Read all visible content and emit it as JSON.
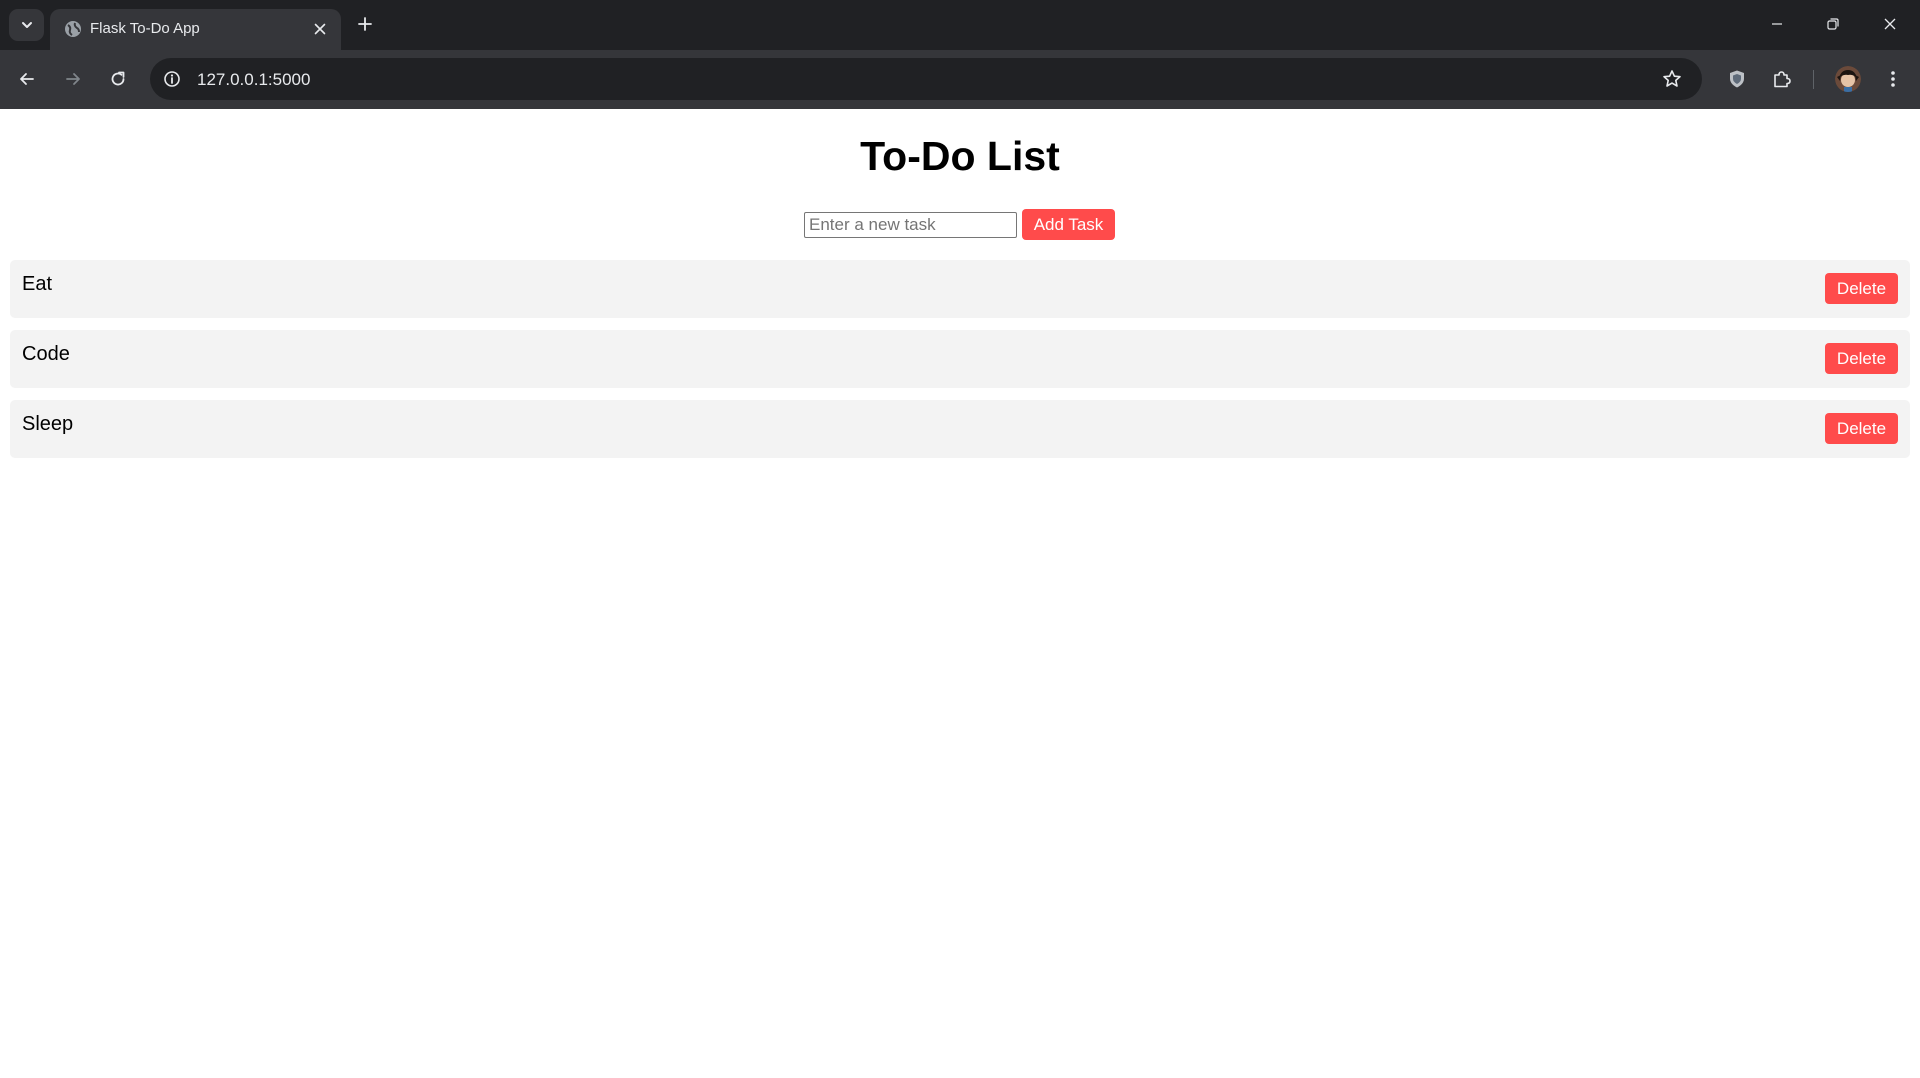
{
  "browser": {
    "tab_title": "Flask To-Do App",
    "url": "127.0.0.1:5000",
    "icons": {
      "tab_search": "chevron-down-icon",
      "favicon": "globe-icon",
      "tab_close": "close-icon",
      "new_tab": "plus-icon",
      "back": "back-arrow-icon",
      "forward": "forward-arrow-icon",
      "reload": "reload-icon",
      "site_info": "info-icon",
      "bookmark": "star-icon",
      "shield": "shield-icon",
      "extensions": "puzzle-icon",
      "menu": "kebab-menu-icon"
    },
    "colors": {
      "tabstrip": "#202124",
      "toolbar": "#35363a",
      "omnibox": "#202124"
    }
  },
  "page": {
    "title": "To-Do List",
    "input": {
      "placeholder": "Enter a new task",
      "value": ""
    },
    "add_button": "Add Task",
    "tasks": [
      {
        "text": "Eat",
        "delete_label": "Delete"
      },
      {
        "text": "Code",
        "delete_label": "Delete"
      },
      {
        "text": "Sleep",
        "delete_label": "Delete"
      }
    ],
    "colors": {
      "accent": "#ff4b4b",
      "task_bg": "#f3f3f3"
    }
  }
}
